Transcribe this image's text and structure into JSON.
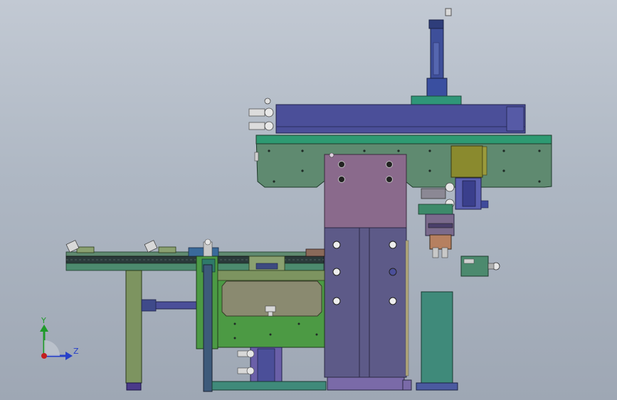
{
  "viewport": {
    "background_top": "#c2c9d3",
    "background_bottom": "#9ea7b4"
  },
  "triad": {
    "y_label": "Y",
    "z_label": "Z",
    "y_color": "#1f9a2a",
    "z_color": "#2740c9",
    "x_color": "#c21f1f"
  },
  "model_colors": {
    "green_plate": "#5f8a70",
    "purple_column": "#8a6a8c",
    "navy_beam": "#4b4f99",
    "teal_post": "#3f8a7a",
    "olive": "#7d9460",
    "bright_green": "#4c9a44"
  }
}
